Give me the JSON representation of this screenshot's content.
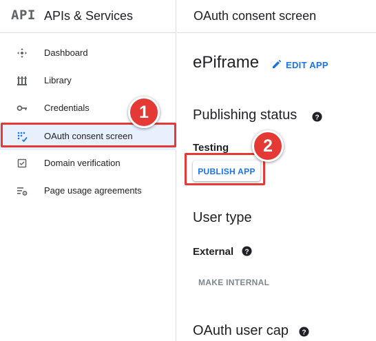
{
  "sidebar": {
    "logo_text": "API",
    "title": "APIs & Services",
    "items": [
      {
        "label": "Dashboard",
        "icon": "dashboard-icon",
        "active": false
      },
      {
        "label": "Library",
        "icon": "library-icon",
        "active": false
      },
      {
        "label": "Credentials",
        "icon": "key-icon",
        "active": false
      },
      {
        "label": "OAuth consent screen",
        "icon": "oauth-icon",
        "active": true
      },
      {
        "label": "Domain verification",
        "icon": "checkbox-icon",
        "active": false
      },
      {
        "label": "Page usage agreements",
        "icon": "settings-list-icon",
        "active": false
      }
    ]
  },
  "header": {
    "title": "OAuth consent screen"
  },
  "app": {
    "name": "ePiframe",
    "edit_label": "EDIT APP"
  },
  "publishing": {
    "heading": "Publishing status",
    "status": "Testing",
    "publish_label": "PUBLISH APP"
  },
  "user_type": {
    "heading": "User type",
    "value": "External",
    "make_internal_label": "MAKE INTERNAL"
  },
  "user_cap": {
    "heading": "OAuth user cap"
  },
  "annotations": {
    "badge_1": "1",
    "badge_2": "2"
  },
  "colors": {
    "accent": "#1a73e8",
    "highlight": "#e53935",
    "active_bg": "#e8f0fe",
    "muted": "#80868b"
  }
}
